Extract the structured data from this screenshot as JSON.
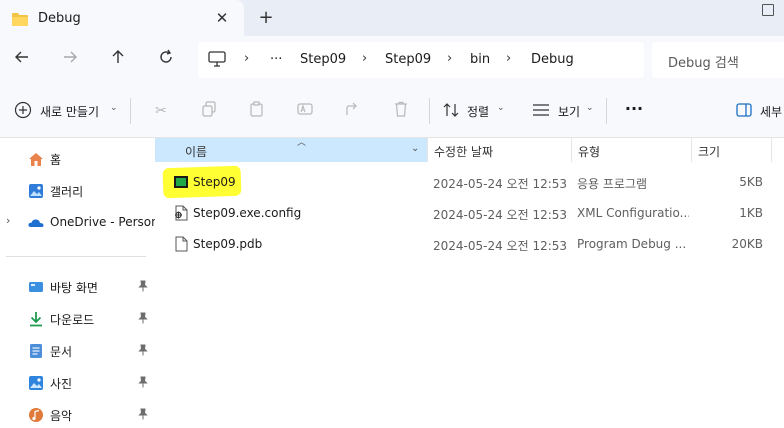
{
  "tab": {
    "title": "Debug",
    "close_glyph": "✕",
    "new_tab_glyph": "+"
  },
  "address": {
    "crumbs": [
      "Step09",
      "Step09",
      "bin",
      "Debug"
    ],
    "more": "···",
    "separator": "›"
  },
  "search": {
    "placeholder": "Debug 검색"
  },
  "toolbar": {
    "new_label": "새로 만들기",
    "sort_label": "정렬",
    "view_label": "보기",
    "more_label": "···",
    "details_label": "세부"
  },
  "sidebar": {
    "items": [
      {
        "label": "홈",
        "icon": "home-icon"
      },
      {
        "label": "갤러리",
        "icon": "gallery-icon"
      },
      {
        "label": "OneDrive - Persona",
        "icon": "onedrive-icon"
      },
      {
        "label": "바탕 화면",
        "icon": "desktop-icon",
        "pinned": true
      },
      {
        "label": "다운로드",
        "icon": "download-icon",
        "pinned": true
      },
      {
        "label": "문서",
        "icon": "documents-icon",
        "pinned": true
      },
      {
        "label": "사진",
        "icon": "pictures-icon",
        "pinned": true
      },
      {
        "label": "음악",
        "icon": "music-icon",
        "pinned": true
      }
    ],
    "expand_glyph": "›",
    "pin_glyph": "📌"
  },
  "columns": {
    "name": "이름",
    "date": "수정한 날짜",
    "type": "유형",
    "size": "크기"
  },
  "files": [
    {
      "name": "Step09",
      "date": "2024-05-24 오전 12:53",
      "type": "응용 프로그램",
      "size": "5KB",
      "icon": "application-icon",
      "highlighted": true
    },
    {
      "name": "Step09.exe.config",
      "date": "2024-05-24 오전 12:53",
      "type": "XML Configuratio...",
      "size": "1KB",
      "icon": "config-file-icon"
    },
    {
      "name": "Step09.pdb",
      "date": "2024-05-24 오전 12:53",
      "type": "Program Debug ...",
      "size": "20KB",
      "icon": "file-icon"
    }
  ],
  "colors": {
    "highlight": "#ffff33",
    "selected_header": "#cce8ff",
    "chrome": "#f7f9fc"
  }
}
